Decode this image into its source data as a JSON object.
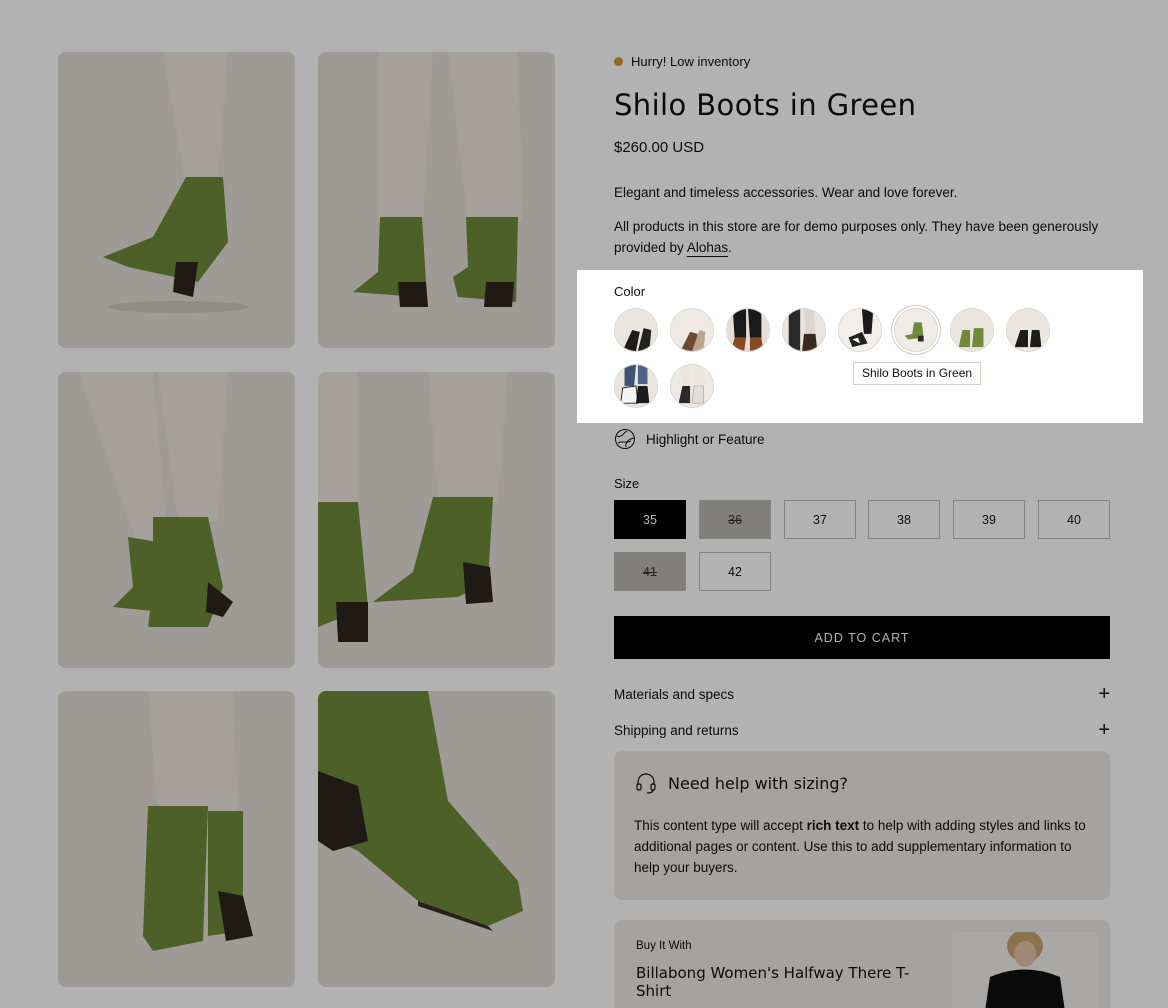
{
  "product": {
    "inventory_note": "Hurry! Low inventory",
    "title": "Shilo Boots in Green",
    "price": "$260.00 USD",
    "description_line1": "Elegant and timeless accessories. Wear and love forever.",
    "description_line2_prefix": "All products in this store are for demo purposes only. They have been generously provided by ",
    "description_line2_link": "Alohas",
    "description_line2_suffix": "."
  },
  "color": {
    "label": "Color",
    "tooltip": "Shilo Boots in Green",
    "selected_index": 5
  },
  "feature": {
    "label": "Highlight or Feature"
  },
  "size": {
    "label": "Size",
    "options": [
      {
        "label": "35",
        "state": "selected"
      },
      {
        "label": "36",
        "state": "unavailable"
      },
      {
        "label": "37",
        "state": "available"
      },
      {
        "label": "38",
        "state": "available"
      },
      {
        "label": "39",
        "state": "available"
      },
      {
        "label": "40",
        "state": "available"
      },
      {
        "label": "41",
        "state": "unavailable"
      },
      {
        "label": "42",
        "state": "available"
      }
    ]
  },
  "cart": {
    "label": "ADD TO CART"
  },
  "accordions": [
    {
      "label": "Materials and specs"
    },
    {
      "label": "Shipping and returns"
    }
  ],
  "help": {
    "title": "Need help with sizing?",
    "body_prefix": "This content type will accept ",
    "body_bold": "rich text",
    "body_suffix": " to help with adding styles and links to additional pages or content. Use this to add supplementary information to help your buyers."
  },
  "buy_with": {
    "label": "Buy It With",
    "product_name": "Billabong Women's Halfway There T-Shirt"
  },
  "colors": {
    "accent_inventory": "#c99b2c",
    "boot_green": "#6e8a3c",
    "button_black": "#000000"
  }
}
